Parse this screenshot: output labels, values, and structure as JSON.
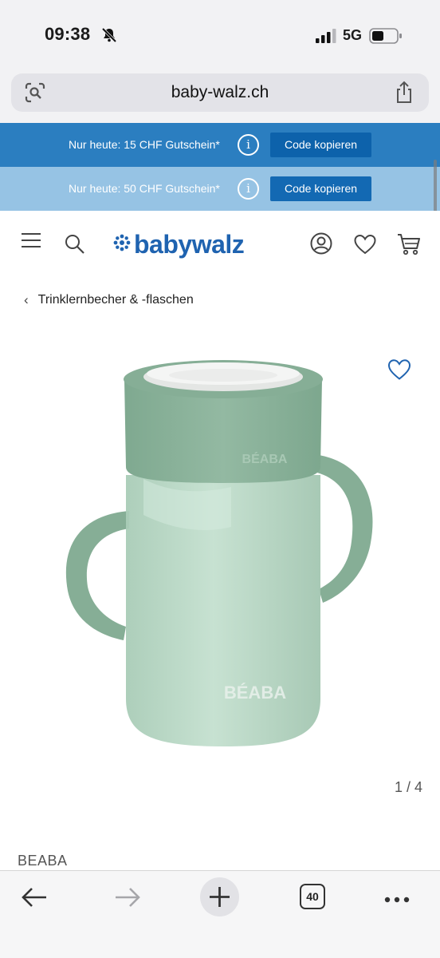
{
  "status_bar": {
    "time": "09:38",
    "network": "5G"
  },
  "browser": {
    "url": "baby-walz.ch",
    "tab_count": "40"
  },
  "promos": [
    {
      "text": "Nur heute: 15 CHF Gutschein*",
      "button": "Code kopieren"
    },
    {
      "text": "Nur heute: 50 CHF Gutschein*",
      "button": "Code kopieren"
    }
  ],
  "header": {
    "logo_text": "babywalz"
  },
  "breadcrumb": {
    "label": "Trinklernbecher & -flaschen"
  },
  "product": {
    "image_counter": "1 / 4",
    "brand": "BEABA",
    "cup_logo": "BÉABA"
  },
  "colors": {
    "promo_primary": "#2b7ec0",
    "promo_secondary": "#96c3e4",
    "button_blue": "#0d62ab",
    "brand_blue": "#1f63b0",
    "product_sage": "#8fb79f"
  }
}
